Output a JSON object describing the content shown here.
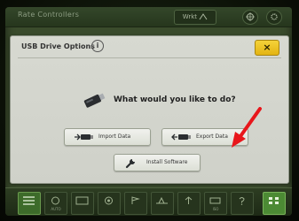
{
  "topbar": {
    "title": "Rate Controllers",
    "signal_label": "Wrkt"
  },
  "dialog": {
    "title": "USB Drive Options",
    "info_glyph": "i",
    "close_glyph": "×",
    "question": "What would you like to do?",
    "actions": [
      {
        "label": "Import Data",
        "icon": "usb-import-icon"
      },
      {
        "label": "Export Data",
        "icon": "usb-export-icon"
      },
      {
        "label": "Install Software",
        "icon": "wrench-icon"
      }
    ]
  },
  "annotation": {
    "arrow_color": "#e8161b"
  },
  "toolbar": {
    "items": [
      {
        "label": "",
        "icon": "menu-icon"
      },
      {
        "label": "AUTO",
        "icon": "auto-icon"
      },
      {
        "label": "",
        "icon": "layout-icon"
      },
      {
        "label": "",
        "icon": "target-icon"
      },
      {
        "label": "",
        "icon": "flag-icon"
      },
      {
        "label": "",
        "icon": "guidance-icon"
      },
      {
        "label": "",
        "icon": "steer-icon"
      },
      {
        "label": "ISO",
        "icon": "iso-icon"
      },
      {
        "label": "",
        "icon": "help-icon"
      },
      {
        "label": "",
        "icon": "grid-icon"
      }
    ]
  },
  "colors": {
    "close_button": "#f5d23a",
    "screen": "#3a4b2c",
    "dialog": "#d7d9d1"
  }
}
